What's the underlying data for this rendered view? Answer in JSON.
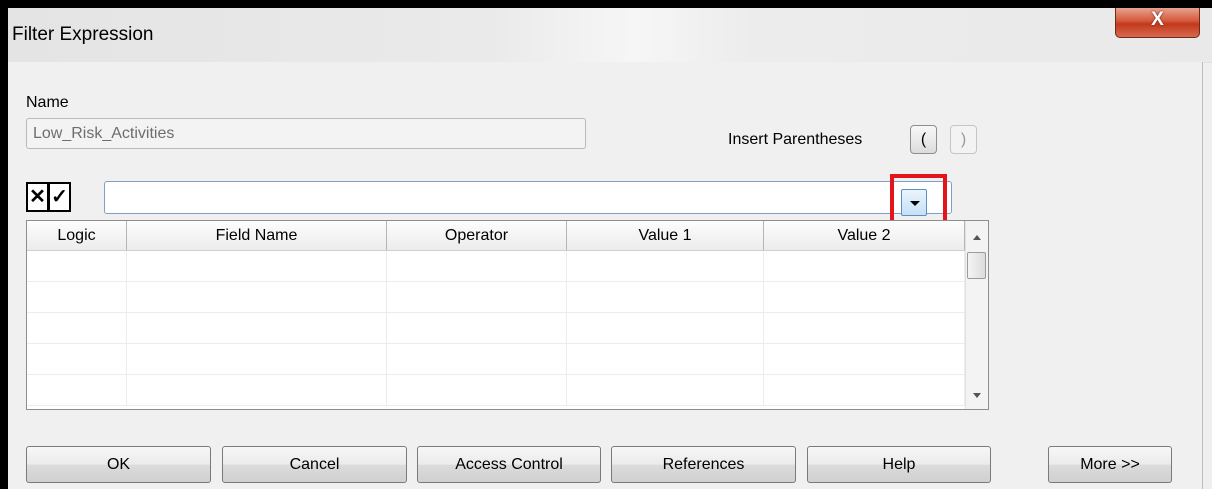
{
  "window": {
    "title": "Filter Expression",
    "close_glyph": "X"
  },
  "form": {
    "name_label": "Name",
    "name_value": "Low_Risk_Activities",
    "insert_parentheses_label": "Insert Parentheses",
    "open_paren": "(",
    "close_paren": ")",
    "cancel_glyph": "✕",
    "accept_glyph": "✓",
    "expression_value": ""
  },
  "grid": {
    "columns": [
      "Logic",
      "Field Name",
      "Operator",
      "Value 1",
      "Value 2"
    ],
    "rows": [
      [
        "",
        "",
        "",
        "",
        ""
      ],
      [
        "",
        "",
        "",
        "",
        ""
      ],
      [
        "",
        "",
        "",
        "",
        ""
      ],
      [
        "",
        "",
        "",
        "",
        ""
      ],
      [
        "",
        "",
        "",
        "",
        ""
      ]
    ]
  },
  "buttons": {
    "ok": "OK",
    "cancel": "Cancel",
    "access_control": "Access Control",
    "references": "References",
    "help": "Help",
    "more": "More >>"
  },
  "icons": {
    "dropdown": "chevron-down-icon",
    "scroll_up": "scroll-up-icon",
    "scroll_down": "scroll-down-icon"
  },
  "colors": {
    "highlight": "#e3151a",
    "close_button": "#c2391d"
  }
}
